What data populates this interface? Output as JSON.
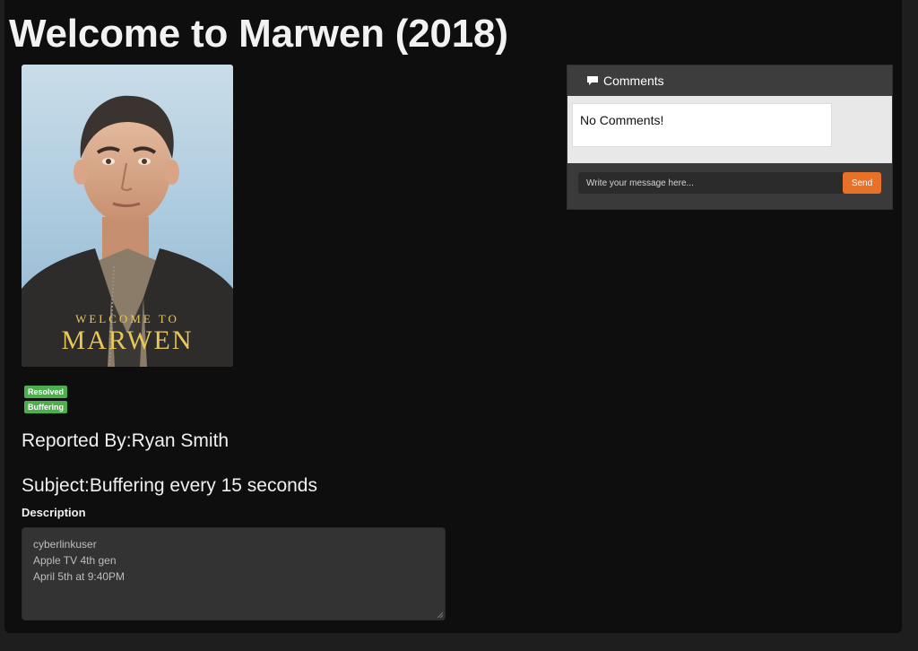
{
  "page": {
    "title": "Welcome to Marwen (2018)"
  },
  "poster": {
    "top_line": "WELCOME TO",
    "title_word": "MARWEN",
    "colors": {
      "sky": "#b8d3e6",
      "jacket": "#2e2c2a",
      "title_gold": "#e9c75a"
    }
  },
  "badges": {
    "status": "Resolved",
    "type": "Buffering",
    "color": "#4cae4c"
  },
  "issue": {
    "reported_by": "Reported By:Ryan Smith",
    "subject": "Subject:Buffering every 15 seconds",
    "description_label": "Description",
    "description_lines": [
      "cyberlinkuser",
      "Apple TV 4th gen",
      "April 5th at 9:40PM"
    ]
  },
  "comments": {
    "title": "Comments",
    "icon": "comment-icon",
    "empty_message": "No Comments!",
    "input_placeholder": "Write your message here...",
    "send_label": "Send",
    "send_color": "#e8712a"
  }
}
